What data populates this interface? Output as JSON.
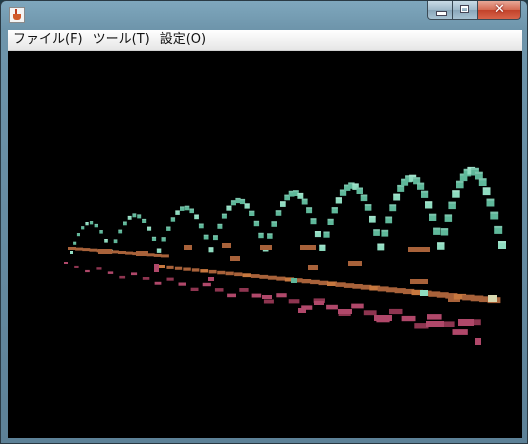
{
  "window": {
    "buttons": {
      "minimize_icon": "minimize-icon",
      "maximize_icon": "maximize-icon",
      "close_glyph": "✕"
    }
  },
  "menubar": {
    "items": [
      {
        "label": "ファイル(F)",
        "name": "menu-file"
      },
      {
        "label": "ツール(T)",
        "name": "menu-tool"
      },
      {
        "label": "設定(O)",
        "name": "menu-settings"
      }
    ]
  },
  "scene": {
    "background": "#000000",
    "colors": {
      "melody": "#5fb89a",
      "melody_bright": "#8fdcc0",
      "bass": "#a8623a",
      "bass_bright": "#c7783f",
      "drum": "#b0486a",
      "drum_dark": "#8e3550",
      "highlight": "#d8d8b0"
    }
  }
}
